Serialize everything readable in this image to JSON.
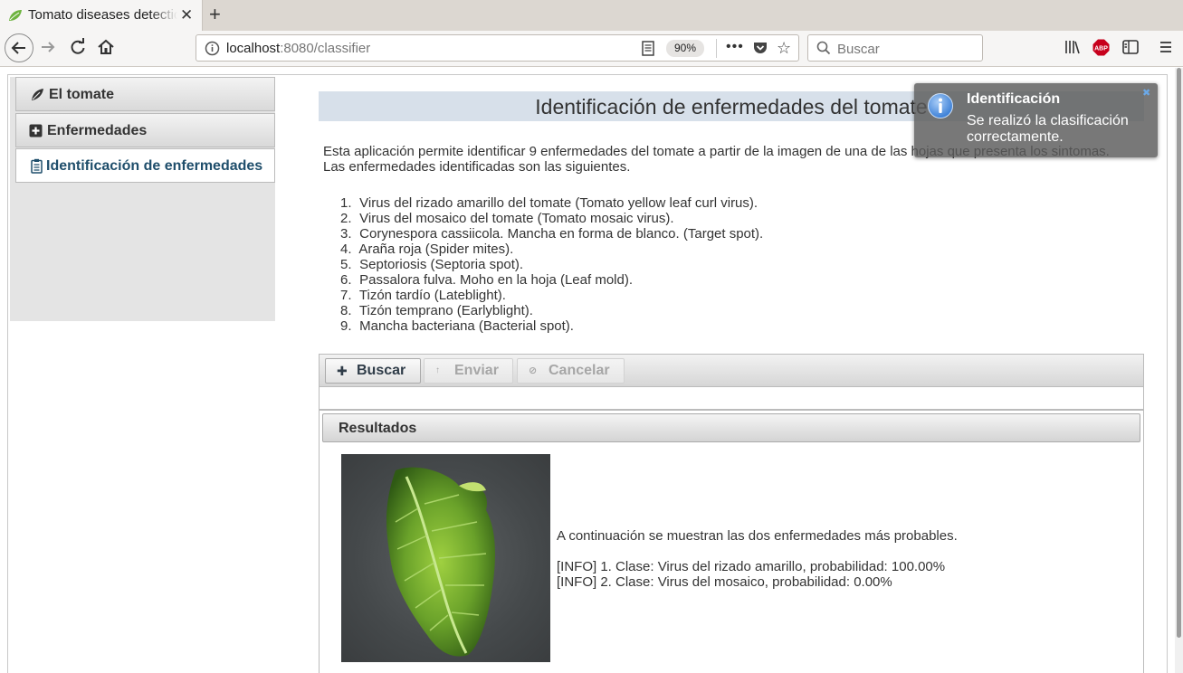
{
  "browser": {
    "tab_title": "Tomato diseases detection",
    "url_host": "localhost",
    "url_rest": ":8080/classifier",
    "zoom": "90%",
    "search_placeholder": "Buscar"
  },
  "sidebar": {
    "items": [
      {
        "label": "El tomate",
        "icon": "leaf-icon"
      },
      {
        "label": "Enfermedades",
        "icon": "plus-square-icon"
      },
      {
        "label": "Identificación de enfermedades",
        "icon": "clipboard-icon"
      }
    ],
    "active_index": 2
  },
  "main": {
    "title": "Identificación de enfermedades del tomate",
    "intro": "Esta aplicación permite identificar 9 enfermedades del tomate a partir de la imagen de una de las hojas que presenta los sintomas. Las enfermedades identificadas son las siguientes.",
    "diseases": [
      {
        "num": "1.",
        "text": "Virus del rizado amarillo del tomate (Tomato yellow leaf curl virus)."
      },
      {
        "num": "2.",
        "text": "Virus del mosaico del tomate (Tomato mosaic virus)."
      },
      {
        "num": "3.",
        "text": "Corynespora cassiicola. Mancha en forma de blanco. (Target spot)."
      },
      {
        "num": "4.",
        "text": "Araña roja (Spider mites)."
      },
      {
        "num": "5.",
        "text": "Septoriosis (Septoria spot)."
      },
      {
        "num": "6.",
        "text": "Passalora fulva. Moho en la hoja (Leaf mold)."
      },
      {
        "num": "7.",
        "text": "Tizón tardío (Lateblight)."
      },
      {
        "num": "8.",
        "text": "Tizón temprano (Earlyblight)."
      },
      {
        "num": "9.",
        "text": "Mancha bacteriana (Bacterial spot)."
      }
    ]
  },
  "upload": {
    "buscar": "Buscar",
    "enviar": "Enviar",
    "cancelar": "Cancelar"
  },
  "results": {
    "header": "Resultados",
    "lead": "A continuación se muestran las dos enfermedades más probables.",
    "line1": "[INFO] 1. Clase: Virus del rizado amarillo, probabilidad: 100.00%",
    "line2": "[INFO] 2. Clase: Virus del mosaico, probabilidad: 0.00%"
  },
  "notification": {
    "title": "Identificación",
    "message": "Se realizó la clasificación correctamente.",
    "icon": "info-icon"
  }
}
